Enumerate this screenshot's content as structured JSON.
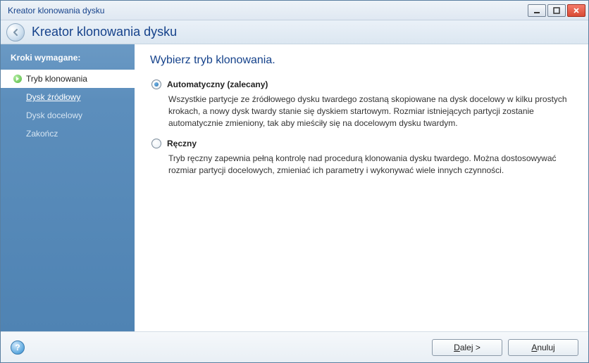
{
  "window": {
    "title": "Kreator klonowania dysku"
  },
  "header": {
    "title": "Kreator klonowania dysku"
  },
  "sidebar": {
    "heading": "Kroki wymagane:",
    "steps": [
      {
        "label": "Tryb klonowania",
        "state": "active"
      },
      {
        "label": "Dysk źródłowy",
        "state": "link"
      },
      {
        "label": "Dysk docelowy",
        "state": "pending"
      },
      {
        "label": "Zakończ",
        "state": "pending"
      }
    ]
  },
  "content": {
    "title": "Wybierz tryb klonowania.",
    "options": [
      {
        "label": "Automatyczny (zalecany)",
        "desc": "Wszystkie partycje ze źródłowego dysku twardego zostaną skopiowane na dysk docelowy w kilku prostych krokach, a nowy dysk twardy stanie się dyskiem startowym. Rozmiar istniejących partycji zostanie automatycznie zmieniony, tak aby mieściły się na docelowym dysku twardym.",
        "selected": true
      },
      {
        "label": "Ręczny",
        "desc": "Tryb ręczny zapewnia pełną kontrolę nad procedurą klonowania dysku twardego. Można dostosowywać rozmiar partycji docelowych, zmieniać ich parametry i wykonywać wiele innych czynności.",
        "selected": false
      }
    ]
  },
  "footer": {
    "next_prefix": "D",
    "next_rest": "alej >",
    "cancel_prefix": "A",
    "cancel_rest": "nuluj"
  }
}
